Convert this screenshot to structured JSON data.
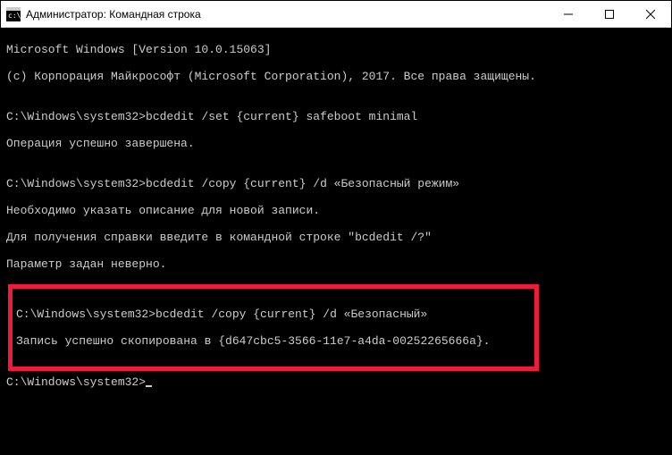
{
  "titlebar": {
    "icon_label": "cmd-icon",
    "title": "Администратор: Командная строка"
  },
  "console": {
    "line1": "Microsoft Windows [Version 10.0.15063]",
    "line2": "(c) Корпорация Майкрософт (Microsoft Corporation), 2017. Все права защищены.",
    "blank1": "",
    "prompt1": "C:\\Windows\\system32>",
    "cmd1": "bcdedit /set {current} safeboot minimal",
    "resp1": "Операция успешно завершена.",
    "blank2": "",
    "prompt2": "C:\\Windows\\system32>",
    "cmd2": "bcdedit /copy {current} /d «Безопасный режим»",
    "resp2a": "Необходимо указать описание для новой записи.",
    "resp2b": "Для получения справки введите в командной строке \"bcdedit /?\"",
    "resp2c": "Параметр задан неверно.",
    "blank3": "",
    "prompt3": "C:\\Windows\\system32>",
    "cmd3": "bcdedit /copy {current} /d «Безопасный»",
    "resp3": "Запись успешно скопирована в {d647cbc5-3566-11e7-a4da-00252265666a}.",
    "blank4": "",
    "prompt4": "C:\\Windows\\system32>"
  }
}
